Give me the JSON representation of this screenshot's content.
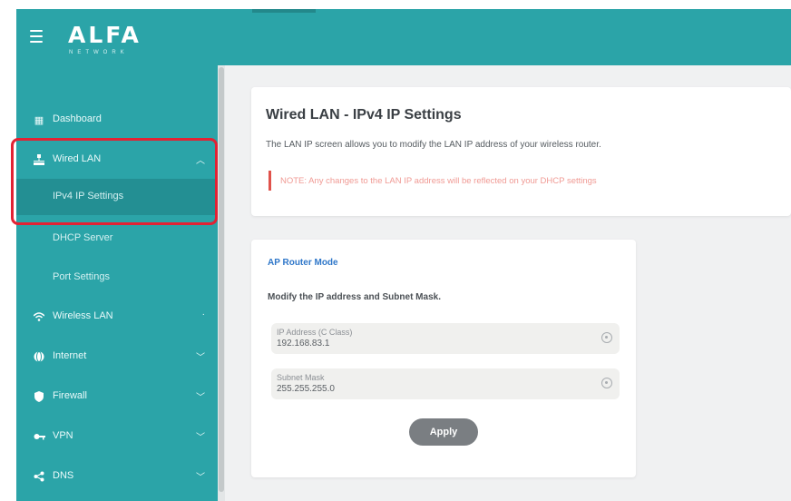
{
  "header": {
    "logo": "ALFA",
    "tagline": "NETWORK"
  },
  "sidebar": {
    "items": [
      {
        "label": "Dashboard",
        "icon": "dashboard-icon"
      },
      {
        "label": "Wired LAN",
        "icon": "wired-lan-icon",
        "expanded": true
      },
      {
        "label": "IPv4 IP Settings",
        "active": true
      },
      {
        "label": "DHCP Server"
      },
      {
        "label": "Port Settings"
      },
      {
        "label": "Wireless LAN",
        "icon": "wifi-icon"
      },
      {
        "label": "Internet",
        "icon": "globe-icon"
      },
      {
        "label": "Firewall",
        "icon": "shield-icon"
      },
      {
        "label": "VPN",
        "icon": "key-icon"
      },
      {
        "label": "DNS",
        "icon": "share-icon"
      }
    ]
  },
  "main": {
    "title": "Wired LAN - IPv4 IP Settings",
    "description": "The LAN IP screen allows you to modify the LAN IP address of your wireless router.",
    "note": "NOTE: Any changes to the LAN IP address will be reflected on your DHCP settings",
    "form": {
      "mode": "AP Router Mode",
      "hint": "Modify the IP address and Subnet Mask.",
      "ip_label": "IP Address (C Class)",
      "ip_value": "192.168.83.1",
      "subnet_label": "Subnet Mask",
      "subnet_value": "255.255.255.0",
      "apply_label": "Apply"
    }
  },
  "colors": {
    "brand_teal": "#2ba4a8",
    "active_item": "#238f93",
    "highlight_red": "#e22233",
    "mode_blue": "#2f77c9",
    "note_red": "#e0524b"
  }
}
